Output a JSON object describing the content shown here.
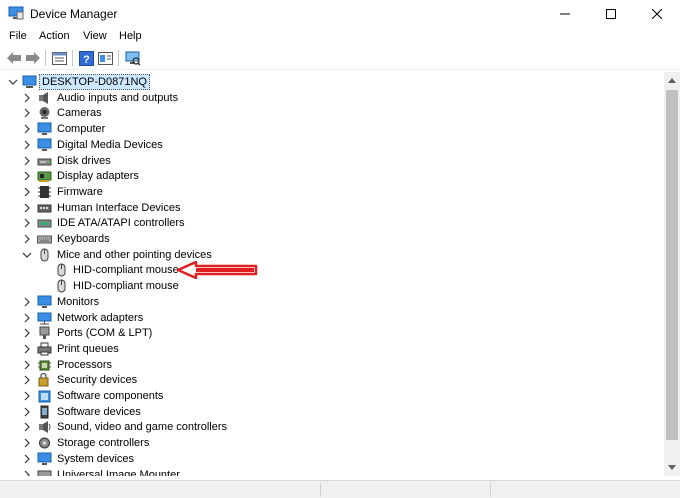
{
  "window": {
    "title": "Device Manager"
  },
  "menu": {
    "items": [
      "File",
      "Action",
      "View",
      "Help"
    ]
  },
  "toolbar": {
    "buttons": [
      "back-arrow-icon",
      "forward-arrow-icon",
      "properties-icon",
      "help-icon",
      "update-driver-icon",
      "scan-hardware-icon"
    ]
  },
  "tree": {
    "root": "DESKTOP-D0871NQ",
    "categories": [
      "Audio inputs and outputs",
      "Cameras",
      "Computer",
      "Digital Media Devices",
      "Disk drives",
      "Display adapters",
      "Firmware",
      "Human Interface Devices",
      "IDE ATA/ATAPI controllers",
      "Keyboards",
      "Mice and other pointing devices",
      "Monitors",
      "Network adapters",
      "Ports (COM & LPT)",
      "Print queues",
      "Processors",
      "Security devices",
      "Software components",
      "Software devices",
      "Sound, video and game controllers",
      "Storage controllers",
      "System devices",
      "Universal Image Mounter"
    ],
    "expanded_category": "Mice and other pointing devices",
    "children": [
      "HID-compliant mouse",
      "HID-compliant mouse"
    ]
  },
  "colors": {
    "accent": "#0078d7",
    "selection": "#cce8ff",
    "annotation": "#e02020"
  }
}
